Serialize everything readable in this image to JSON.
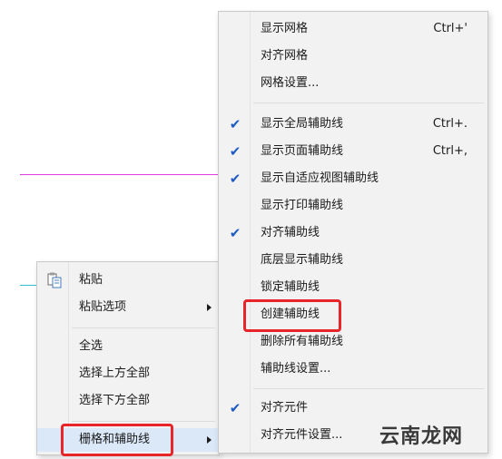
{
  "colors": {
    "guide_magenta": "#e23ce0",
    "guide_cyan": "#36c0cf",
    "check_blue": "#1f5bc4",
    "highlight_red": "#e8262a"
  },
  "left_menu": {
    "items": [
      {
        "label": "粘贴",
        "icon": "paste-icon"
      },
      {
        "label": "粘贴选项",
        "submenu": true
      },
      {
        "label": "全选"
      },
      {
        "label": "选择上方全部"
      },
      {
        "label": "选择下方全部"
      },
      {
        "label": "栅格和辅助线",
        "submenu": true,
        "highlighted": true
      }
    ]
  },
  "right_menu": {
    "items": [
      {
        "label": "显示网格",
        "shortcut": "Ctrl+'"
      },
      {
        "label": "对齐网格"
      },
      {
        "label": "网格设置..."
      },
      {
        "label": "显示全局辅助线",
        "shortcut": "Ctrl+.",
        "checked": true
      },
      {
        "label": "显示页面辅助线",
        "shortcut": "Ctrl+,",
        "checked": true
      },
      {
        "label": "显示自适应视图辅助线",
        "checked": true
      },
      {
        "label": "显示打印辅助线"
      },
      {
        "label": "对齐辅助线",
        "checked": true
      },
      {
        "label": "底层显示辅助线"
      },
      {
        "label": "锁定辅助线"
      },
      {
        "label": "创建辅助线",
        "highlighted": true
      },
      {
        "label": "删除所有辅助线"
      },
      {
        "label": "辅助线设置..."
      },
      {
        "label": "对齐元件",
        "checked": true
      },
      {
        "label": "对齐元件设置..."
      }
    ]
  },
  "watermark": "云南龙网"
}
